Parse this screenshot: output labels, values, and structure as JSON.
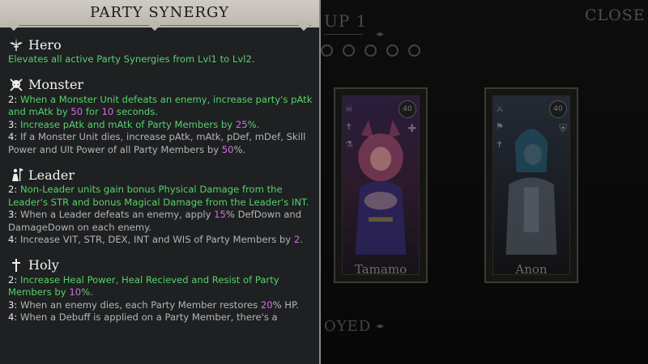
{
  "background": {
    "group_title": "UP 1",
    "close_label": "CLOSE",
    "deployed_label": "OYED",
    "cards": [
      {
        "name": "Tamamo",
        "level": "40"
      },
      {
        "name": "Anon",
        "level": "40"
      }
    ]
  },
  "panel": {
    "title": "PARTY SYNERGY",
    "sections": [
      {
        "name": "Hero",
        "icon": "winged-sword-icon",
        "lines": [
          [
            {
              "t": "Elevates all active Party Synergies from Lvl1 to Lvl2.",
              "c": "g"
            }
          ]
        ]
      },
      {
        "name": "Monster",
        "icon": "skull-crossbones-icon",
        "lines": [
          [
            {
              "t": "2: ",
              "c": "lbl"
            },
            {
              "t": "When a Monster Unit defeats an enemy, increase party's pAtk and mAtk by ",
              "c": "g"
            },
            {
              "t": "50",
              "c": "p"
            },
            {
              "t": " for ",
              "c": "g"
            },
            {
              "t": "10",
              "c": "p"
            },
            {
              "t": " seconds.",
              "c": "g"
            }
          ],
          [
            {
              "t": "3: ",
              "c": "lbl"
            },
            {
              "t": "Increase pAtk and mAtk of Party Members by ",
              "c": "g"
            },
            {
              "t": "25",
              "c": "p"
            },
            {
              "t": "%.",
              "c": "g"
            }
          ],
          [
            {
              "t": "4: ",
              "c": "lbl"
            },
            {
              "t": "If a Monster Unit dies, increase pAtk, mAtk, pDef, mDef, Skill Power and Ult Power of all Party Members by ",
              "c": ""
            },
            {
              "t": "50",
              "c": "p"
            },
            {
              "t": "%.",
              "c": ""
            }
          ]
        ]
      },
      {
        "name": "Leader",
        "icon": "flag-bearer-icon",
        "lines": [
          [
            {
              "t": "2: ",
              "c": "lbl"
            },
            {
              "t": "Non-Leader units gain bonus Physical Damage from the Leader's STR and bonus Magical Damage from the Leader's INT.",
              "c": "g"
            }
          ],
          [
            {
              "t": "3: ",
              "c": "lbl"
            },
            {
              "t": "When a Leader defeats an enemy, apply ",
              "c": ""
            },
            {
              "t": "15",
              "c": "p"
            },
            {
              "t": "% DefDown and DamageDown on each enemy.",
              "c": ""
            }
          ],
          [
            {
              "t": "4: ",
              "c": "lbl"
            },
            {
              "t": "Increase VIT, STR, DEX, INT and WIS of Party Members by ",
              "c": ""
            },
            {
              "t": "2",
              "c": "p"
            },
            {
              "t": ".",
              "c": ""
            }
          ]
        ]
      },
      {
        "name": "Holy",
        "icon": "holy-cross-icon",
        "lines": [
          [
            {
              "t": "2: ",
              "c": "lbl"
            },
            {
              "t": "Increase Heal Power, Heal Recieved and Resist of Party Members by ",
              "c": "g"
            },
            {
              "t": "10",
              "c": "p"
            },
            {
              "t": "%.",
              "c": "g"
            }
          ],
          [
            {
              "t": "3: ",
              "c": "lbl"
            },
            {
              "t": "When an enemy dies, each Party Member restores ",
              "c": ""
            },
            {
              "t": "20",
              "c": "p"
            },
            {
              "t": "% HP.",
              "c": ""
            }
          ],
          [
            {
              "t": "4: ",
              "c": "lbl"
            },
            {
              "t": "When a Debuff is applied on a Party Member, there's a",
              "c": ""
            }
          ]
        ]
      }
    ]
  },
  "colors": {
    "green_text": "#57d16b",
    "purple_value": "#d66be0",
    "panel_bg": "#1e2022",
    "header_bg": "#c8c3bc"
  }
}
